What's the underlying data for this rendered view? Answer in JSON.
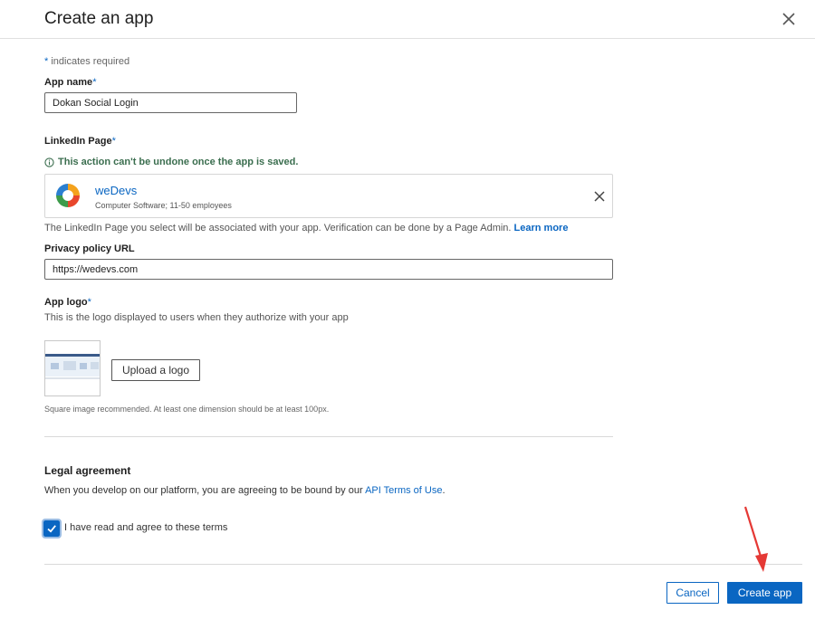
{
  "header": {
    "title": "Create an app",
    "close_icon": "close-icon"
  },
  "required_note": {
    "star": "*",
    "text": " indicates required"
  },
  "app_name": {
    "label": "App name",
    "star": "*",
    "value": "Dokan Social Login"
  },
  "linkedin_page": {
    "label": "LinkedIn Page",
    "star": "*",
    "warning": "This action can't be undone once the app is saved.",
    "card": {
      "name": "weDevs",
      "meta": "Computer Software; 11-50 employees"
    },
    "help_text": "The LinkedIn Page you select will be associated with your app. Verification can be done by a Page Admin. ",
    "learn_more": "Learn more"
  },
  "privacy": {
    "label": "Privacy policy URL",
    "value": "https://wedevs.com"
  },
  "app_logo": {
    "label": "App logo",
    "star": "*",
    "description": "This is the logo displayed to users when they authorize with your app",
    "upload_label": "Upload a logo",
    "hint": "Square image recommended. At least one dimension should be at least 100px."
  },
  "legal": {
    "title": "Legal agreement",
    "text": "When you develop on our platform, you are agreeing to be bound by our ",
    "link": "API Terms of Use",
    "suffix": ".",
    "checkbox_label": "I have read and agree to these terms",
    "checked": true
  },
  "footer": {
    "cancel_label": "Cancel",
    "create_label": "Create app"
  },
  "colors": {
    "accent": "#0a66c2",
    "arrow": "#e53935",
    "warning": "#3b6e4f"
  }
}
